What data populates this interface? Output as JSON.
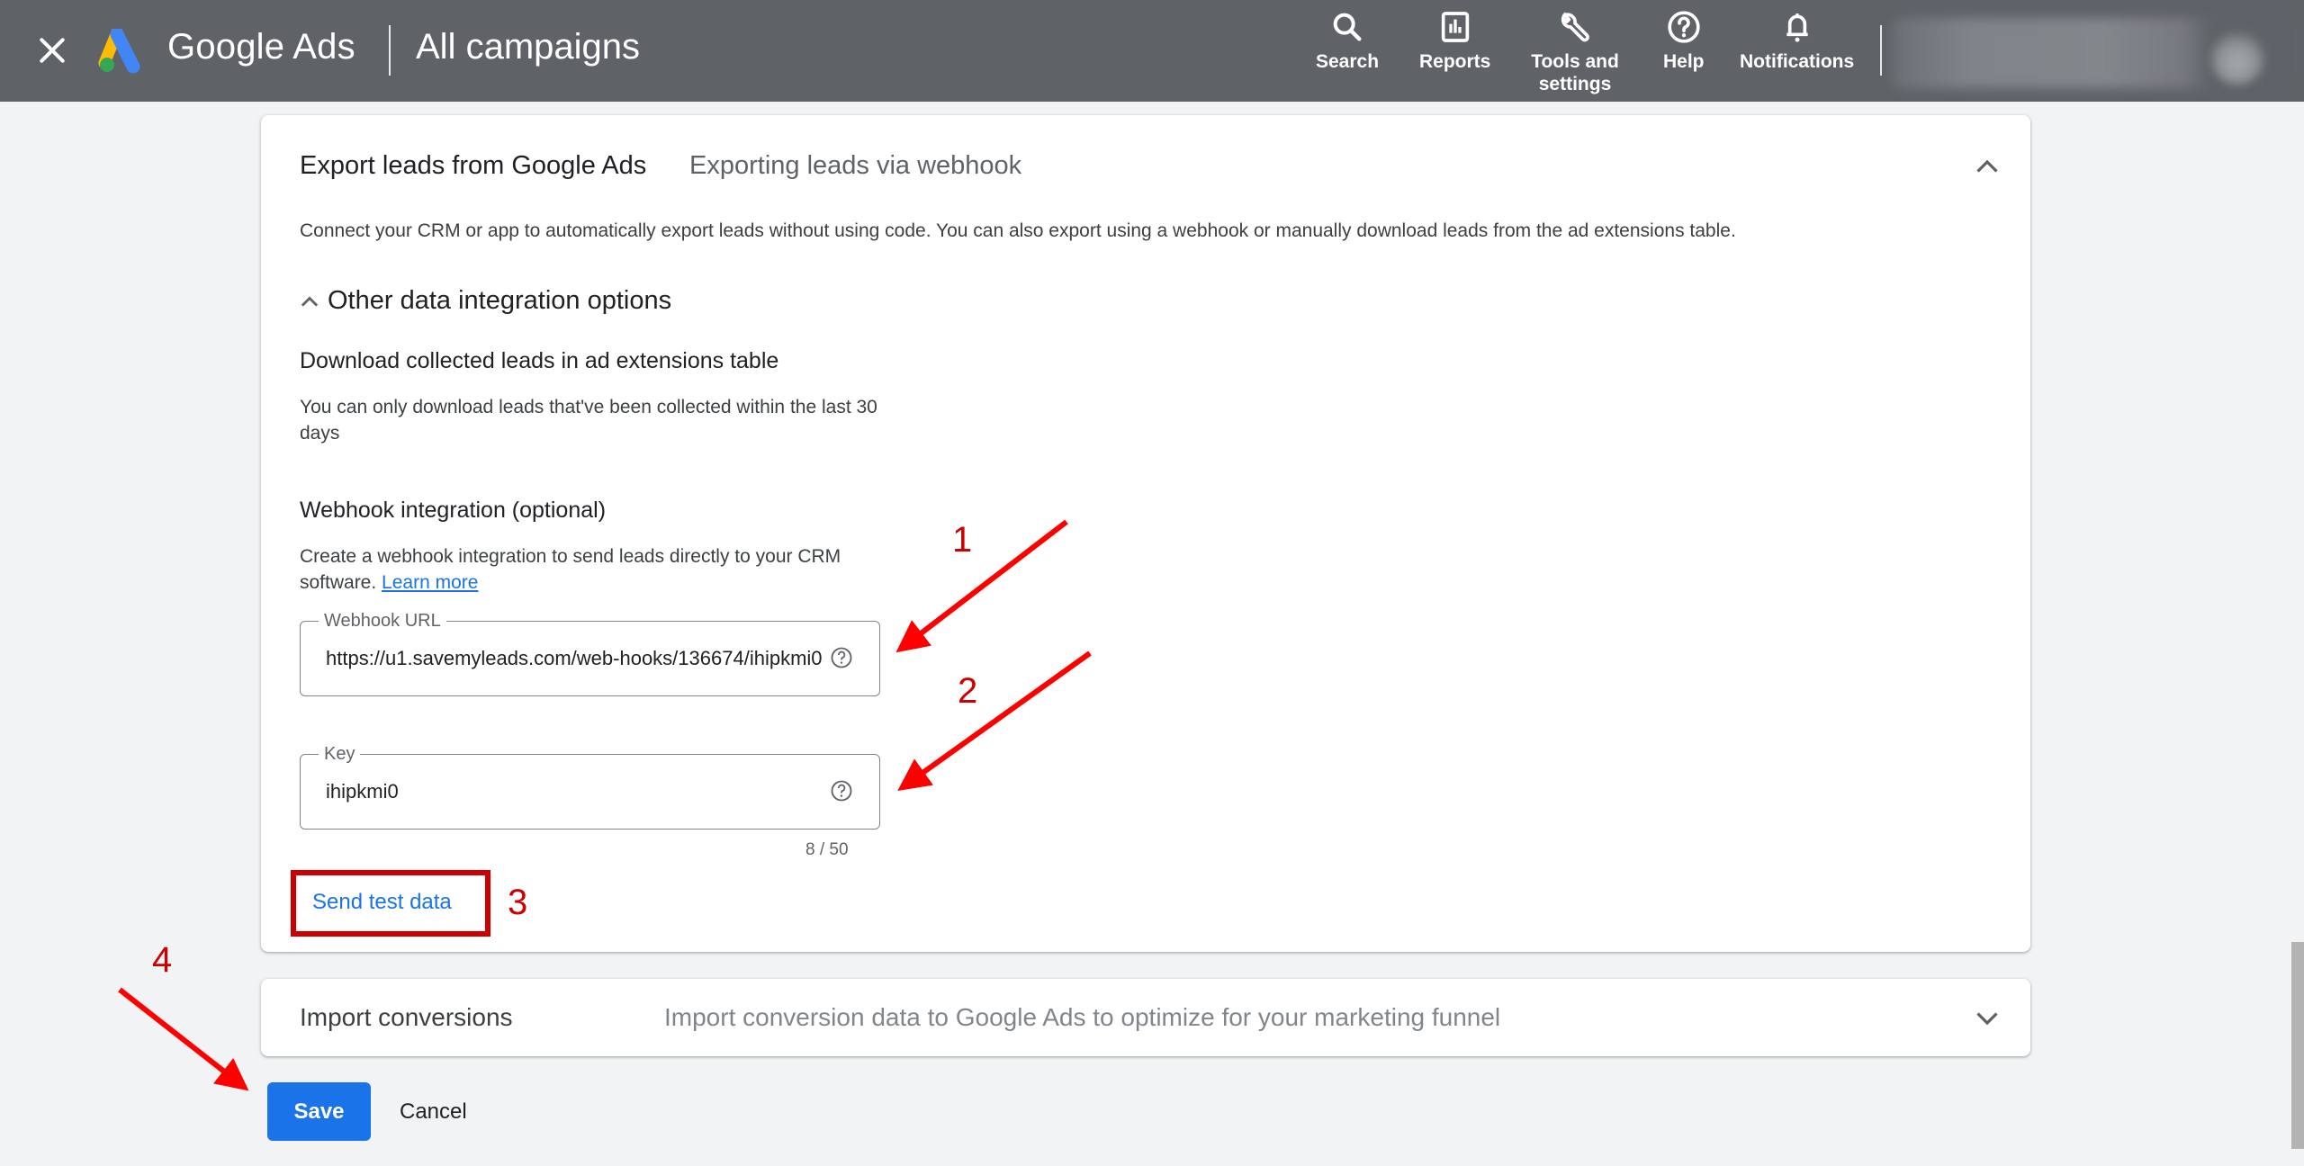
{
  "topbar": {
    "close_icon": "close-icon",
    "logo": "google-ads-logo",
    "brand": "Google Ads",
    "page_title": "All campaigns",
    "nav": [
      {
        "label": "Search",
        "icon": "search-icon"
      },
      {
        "label": "Reports",
        "icon": "reports-icon"
      },
      {
        "label": "Tools and settings",
        "icon": "wrench-icon"
      },
      {
        "label": "Help",
        "icon": "help-icon"
      },
      {
        "label": "Notifications",
        "icon": "bell-icon"
      }
    ],
    "account": "blurred-account-info"
  },
  "export_card": {
    "title": "Export leads from Google Ads",
    "subtitle": "Exporting leads via webhook",
    "expanded": true,
    "description": "Connect your CRM or app to automatically export leads without using code. You can also export using a webhook or manually download leads from the ad extensions table.",
    "other_options_label": "Other data integration options",
    "download": {
      "heading": "Download collected leads in ad extensions table",
      "body": "You can only download leads that've been collected within the last 30 days"
    },
    "webhook": {
      "heading": "Webhook integration (optional)",
      "body": "Create a webhook integration to send leads directly to your CRM software.",
      "learn_more": "Learn more",
      "url_label": "Webhook URL",
      "url_value": "https://u1.savemyleads.com/web-hooks/136674/ihipkmi0",
      "key_label": "Key",
      "key_value": "ihipkmi0",
      "key_counter": "8 / 50",
      "send_test": "Send test data"
    }
  },
  "import_card": {
    "title": "Import conversions",
    "subtitle": "Import conversion data to Google Ads to optimize for your marketing funnel",
    "expanded": false
  },
  "actions": {
    "save": "Save",
    "cancel": "Cancel"
  },
  "annotations": {
    "color": "#cc0000",
    "arrow_color": "#ff0000",
    "labels": [
      "1",
      "2",
      "3",
      "4"
    ]
  },
  "colors": {
    "topbar": "#5f6368",
    "primary": "#1a73e8",
    "page_bg": "#f1f3f4"
  }
}
